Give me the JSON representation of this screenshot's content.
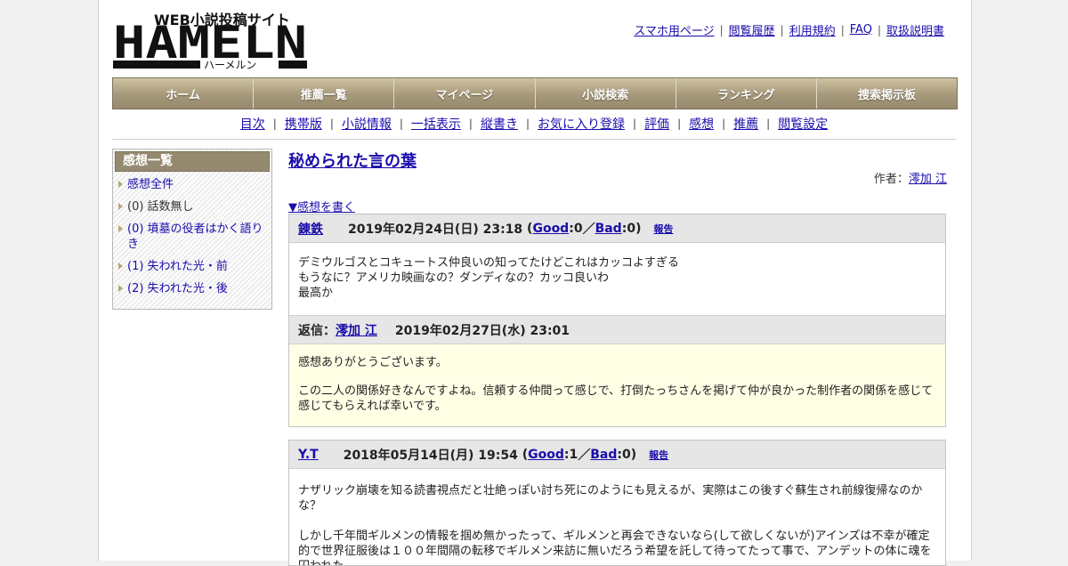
{
  "header": {
    "logo_text": "HAMELN",
    "logo_tagline": "WEB小説投稿サイト",
    "logo_kana": "ハーメルン",
    "links": [
      "スマホ用ページ",
      "閲覧履歴",
      "利用規約",
      "FAQ",
      "取扱説明書"
    ]
  },
  "global_nav": [
    "ホーム",
    "推薦一覧",
    "マイページ",
    "小説検索",
    "ランキング",
    "捜索掲示板"
  ],
  "novel_nav": [
    "目次",
    "携帯版",
    "小説情報",
    "一括表示",
    "縦書き",
    "お気に入り登録",
    "評価",
    "感想",
    "推薦",
    "閲覧設定"
  ],
  "sidebar": {
    "title": "感想一覧",
    "items": [
      {
        "label": "感想全件",
        "link": true
      },
      {
        "label": "(0) 話数無し",
        "link": false
      },
      {
        "label": "(0) 墳墓の役者はかく語りき",
        "link": true
      },
      {
        "label": "(1) 失われた光・前",
        "link": true
      },
      {
        "label": "(2) 失われた光・後",
        "link": true
      }
    ]
  },
  "main": {
    "novel_title": "秘められた言の葉",
    "author_label": "作者：",
    "author_name": "澪加 江",
    "write_link": "▼感想を書く",
    "reviews": [
      {
        "user": "錬鉄",
        "date": "2019年02月24日(日) 23:18",
        "good_label": "Good",
        "good_count": "0",
        "bad_label": "Bad",
        "bad_count": "0",
        "report_label": "報告",
        "body": "デミウルゴスとコキュートス仲良いの知ってたけどこれはカッコよすぎる\nもうなに？アメリカ映画なの？ダンディなの？カッコ良いわ\n最高か",
        "reply": {
          "label": "返信：",
          "author": "澪加 江",
          "date": "2019年02月27日(水) 23:01",
          "paragraphs": [
            "感想ありがとうございます。",
            "この二人の関係好きなんですよね。信頼する仲間って感じで、打倒たっちさんを掲げて仲が良かった制作者の関係を感じて感じてもらえれば幸いです。"
          ]
        }
      },
      {
        "user": "Y.T",
        "date": "2018年05月14日(月) 19:54",
        "good_label": "Good",
        "good_count": "1",
        "bad_label": "Bad",
        "bad_count": "0",
        "report_label": "報告",
        "body": "ナザリック崩壊を知る読書視点だと壮絶っぽい討ち死にのようにも見えるが、実際はこの後すぐ蘇生され前線復帰なのかな？\n\nしかし千年間ギルメンの情報を掴め無かったって、ギルメンと再会できないなら(して欲しくないが)アインズは不幸が確定的で世界征服後は１００年間隔の転移でギルメン来訪に無いだろう希望を託して待ってたって事で、アンデットの体に魂を囚われた"
      }
    ]
  },
  "colors": {
    "nav_gradient_top": "#cfc3a2",
    "nav_gradient_bottom": "#968a6c",
    "link": "#1a0dab",
    "reply_bg": "#ffffe6",
    "card_head_bg": "#e6e6e6"
  }
}
